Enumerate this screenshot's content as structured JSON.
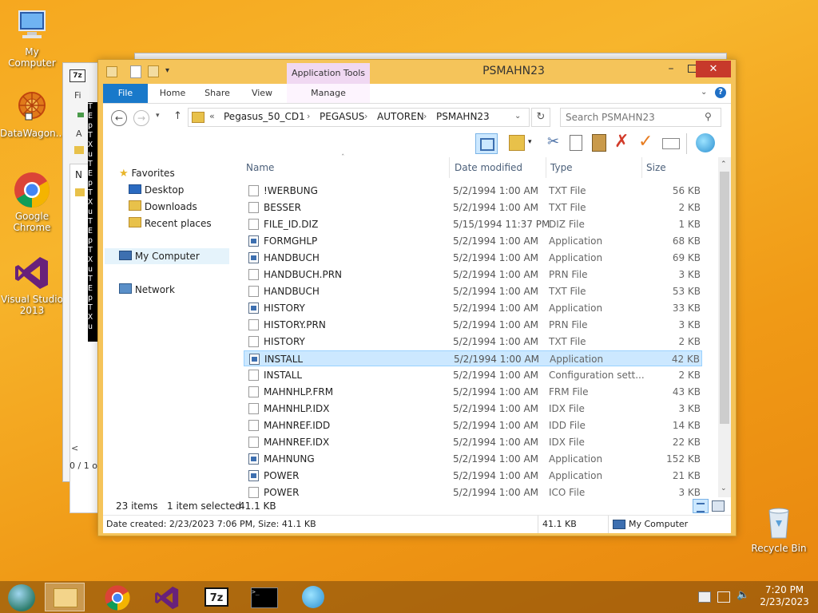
{
  "desktop": {
    "icons": [
      {
        "label": "My Computer",
        "icon": "computer-icon"
      },
      {
        "label": "DataWagon...",
        "icon": "datawagon-icon"
      },
      {
        "label": "Google Chrome",
        "icon": "chrome-icon"
      },
      {
        "label": "Visual Studio 2013",
        "icon": "visual-studio-icon"
      },
      {
        "label": "Recycle Bin",
        "icon": "recycle-bin-icon"
      }
    ]
  },
  "bg_window": {
    "title_icon": "7z",
    "menu_fi": "Fi",
    "list_n": "N",
    "status_text": "0 / 1 o",
    "side_letters": "A"
  },
  "console_strip": "TEpTXuTEpTXuTEpTXuTEpTXu",
  "window": {
    "title": "PSMAHN23",
    "context_tab": "Application Tools",
    "tabs": [
      "File",
      "Home",
      "Share",
      "View",
      "Manage"
    ],
    "address": {
      "chevron": "«",
      "parts": [
        "Pegasus_50_CD1",
        "PEGASUS",
        "AUTOREN",
        "PSMAHN23"
      ]
    },
    "search_placeholder": "Search PSMAHN23",
    "nav": {
      "favorites": "Favorites",
      "desktop": "Desktop",
      "downloads": "Downloads",
      "recent": "Recent places",
      "my_computer": "My Computer",
      "network": "Network"
    },
    "columns": {
      "name": "Name",
      "date": "Date modified",
      "type": "Type",
      "size": "Size"
    },
    "files": [
      {
        "name": "!WERBUNG",
        "date": "5/2/1994 1:00 AM",
        "type": "TXT File",
        "size": "56 KB",
        "kind": "txt"
      },
      {
        "name": "BESSER",
        "date": "5/2/1994 1:00 AM",
        "type": "TXT File",
        "size": "2 KB",
        "kind": "txt"
      },
      {
        "name": "FILE_ID.DIZ",
        "date": "5/15/1994 11:37 PM",
        "type": "DIZ File",
        "size": "1 KB",
        "kind": "txt"
      },
      {
        "name": "FORMGHLP",
        "date": "5/2/1994 1:00 AM",
        "type": "Application",
        "size": "68 KB",
        "kind": "app"
      },
      {
        "name": "HANDBUCH",
        "date": "5/2/1994 1:00 AM",
        "type": "Application",
        "size": "69 KB",
        "kind": "app"
      },
      {
        "name": "HANDBUCH.PRN",
        "date": "5/2/1994 1:00 AM",
        "type": "PRN File",
        "size": "3 KB",
        "kind": "txt"
      },
      {
        "name": "HANDBUCH",
        "date": "5/2/1994 1:00 AM",
        "type": "TXT File",
        "size": "53 KB",
        "kind": "txt"
      },
      {
        "name": "HISTORY",
        "date": "5/2/1994 1:00 AM",
        "type": "Application",
        "size": "33 KB",
        "kind": "app"
      },
      {
        "name": "HISTORY.PRN",
        "date": "5/2/1994 1:00 AM",
        "type": "PRN File",
        "size": "3 KB",
        "kind": "txt"
      },
      {
        "name": "HISTORY",
        "date": "5/2/1994 1:00 AM",
        "type": "TXT File",
        "size": "2 KB",
        "kind": "txt"
      },
      {
        "name": "INSTALL",
        "date": "5/2/1994 1:00 AM",
        "type": "Application",
        "size": "42 KB",
        "kind": "app",
        "selected": true
      },
      {
        "name": "INSTALL",
        "date": "5/2/1994 1:00 AM",
        "type": "Configuration sett...",
        "size": "2 KB",
        "kind": "cfg"
      },
      {
        "name": "MAHNHLP.FRM",
        "date": "5/2/1994 1:00 AM",
        "type": "FRM File",
        "size": "43 KB",
        "kind": "txt"
      },
      {
        "name": "MAHNHLP.IDX",
        "date": "5/2/1994 1:00 AM",
        "type": "IDX File",
        "size": "3 KB",
        "kind": "txt"
      },
      {
        "name": "MAHNREF.IDD",
        "date": "5/2/1994 1:00 AM",
        "type": "IDD File",
        "size": "14 KB",
        "kind": "txt"
      },
      {
        "name": "MAHNREF.IDX",
        "date": "5/2/1994 1:00 AM",
        "type": "IDX File",
        "size": "22 KB",
        "kind": "txt"
      },
      {
        "name": "MAHNUNG",
        "date": "5/2/1994 1:00 AM",
        "type": "Application",
        "size": "152 KB",
        "kind": "app"
      },
      {
        "name": "POWER",
        "date": "5/2/1994 1:00 AM",
        "type": "Application",
        "size": "21 KB",
        "kind": "app"
      },
      {
        "name": "POWER",
        "date": "5/2/1994 1:00 AM",
        "type": "ICO File",
        "size": "3 KB",
        "kind": "ico"
      }
    ],
    "status": {
      "items": "23 items",
      "selected": "1 item selected",
      "selected_size": "41.1 KB"
    },
    "details_bar": {
      "text": "Date created: 2/23/2023 7:06 PM, Size: 41.1 KB",
      "size": "41.1 KB",
      "location": "My Computer"
    }
  },
  "taskbar": {
    "time": "7:20 PM",
    "date": "2/23/2023",
    "apps": [
      "start-orb-icon",
      "file-explorer-icon",
      "chrome-icon",
      "visual-studio-icon",
      "7zip-icon",
      "cmd-icon",
      "shell-icon"
    ]
  },
  "colors": {
    "ribbon_file_tab": "#1979ca",
    "context_tab": "#f0d8f2",
    "selection": "#cce8ff",
    "close_button": "#c7392b"
  }
}
